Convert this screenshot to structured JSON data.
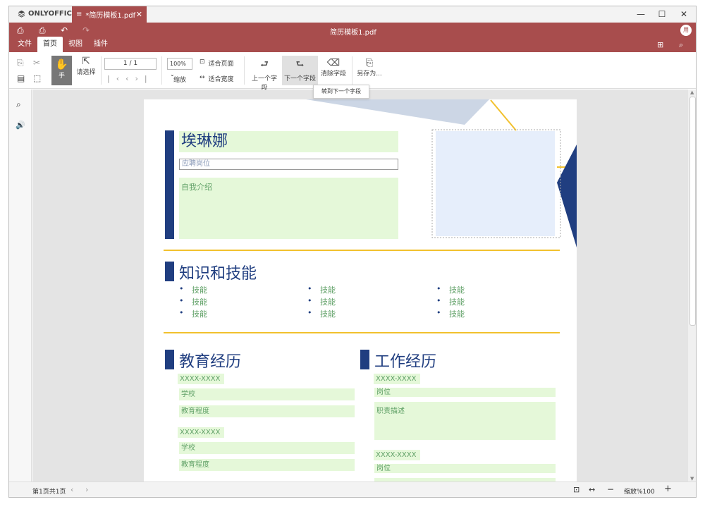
{
  "app": {
    "name": "ONLYOFFICE"
  },
  "tab": {
    "title": "*简历模板1.pdf"
  },
  "header": {
    "title": "简历模板1.pdf",
    "user_initial": "用"
  },
  "menu_tabs": [
    "文件",
    "首页",
    "视图",
    "插件"
  ],
  "toolbar": {
    "hand_label": "手",
    "select_label": "请选择",
    "page_value": "1 / 1",
    "zoom_value": "100%",
    "zoom_label": "缩放",
    "fit_page": "适合页面",
    "fit_width": "适合宽度",
    "prev_field": "上一个字段",
    "next_field": "下一个字段",
    "clear_field": "清除字段",
    "save_as": "另存为...",
    "tooltip": "转到下一个字段"
  },
  "document": {
    "name": "埃琳娜",
    "job_placeholder": "应聘岗位",
    "intro_placeholder": "自我介绍",
    "skills_heading": "知识和技能",
    "skills": [
      "技能",
      "技能",
      "技能",
      "技能",
      "技能",
      "技能",
      "技能",
      "技能",
      "技能"
    ],
    "education_heading": "教育经历",
    "work_heading": "工作经历",
    "education": [
      {
        "years": "XXXX-XXXX",
        "school": "学校",
        "degree": "教育程度"
      },
      {
        "years": "XXXX-XXXX",
        "school": "学校",
        "degree": "教育程度"
      }
    ],
    "work": [
      {
        "years": "XXXX-XXXX",
        "position": "岗位",
        "desc": "职责描述"
      },
      {
        "years": "XXXX-XXXX",
        "position": "岗位"
      }
    ]
  },
  "status": {
    "page_info": "第1页共1页",
    "zoom": "缩放%100"
  },
  "colors": {
    "brand": "#a84d4d",
    "navy": "#203e80",
    "yellow": "#f2c12e",
    "field": "#e5f8d9"
  }
}
